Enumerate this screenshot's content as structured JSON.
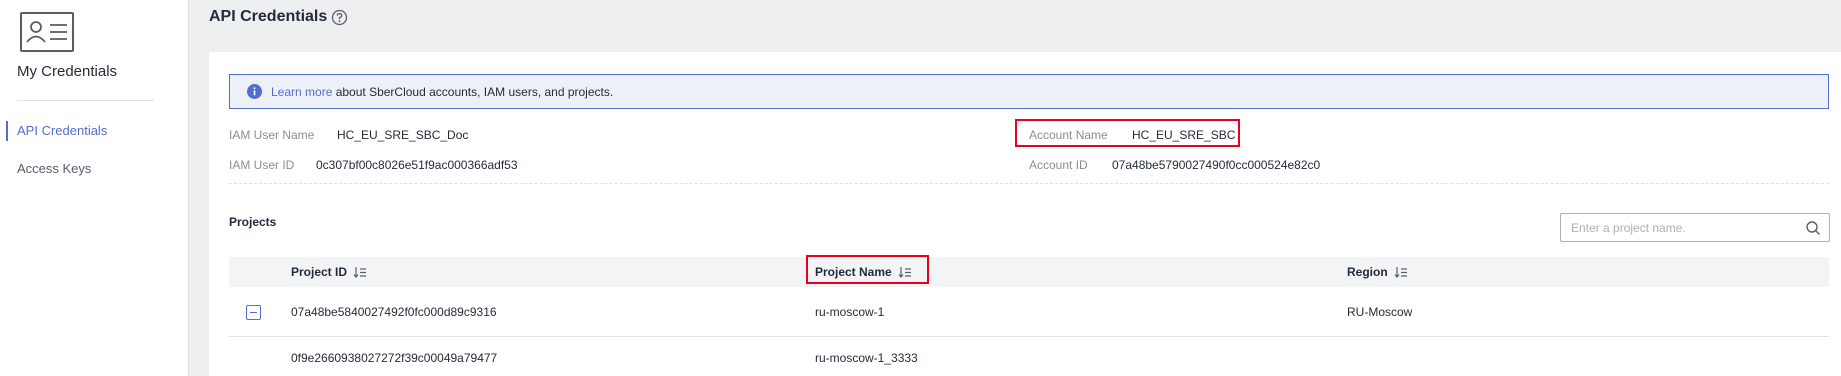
{
  "sidebar": {
    "title": "My Credentials",
    "items": [
      {
        "label": "API Credentials"
      },
      {
        "label": "Access Keys"
      }
    ]
  },
  "header": {
    "title": "API Credentials"
  },
  "banner": {
    "link": "Learn more",
    "text": " about SberCloud accounts, IAM users, and projects."
  },
  "credentials": {
    "iam_user_name_label": "IAM User Name",
    "iam_user_name": "HC_EU_SRE_SBC_Doc",
    "iam_user_id_label": "IAM User ID",
    "iam_user_id": "0c307bf00c8026e51f9ac000366adf53",
    "account_name_label": "Account Name",
    "account_name": "HC_EU_SRE_SBC",
    "account_id_label": "Account ID",
    "account_id": "07a48be5790027490f0cc000524e82c0"
  },
  "projects": {
    "title": "Projects",
    "search_placeholder": "Enter a project name.",
    "columns": [
      "Project ID",
      "Project Name",
      "Region"
    ],
    "rows": [
      {
        "id": "07a48be5840027492f0fc000d89c9316",
        "name": "ru-moscow-1",
        "region": "RU-Moscow"
      },
      {
        "id": "0f9e2660938027272f39c00049a79477",
        "name": "ru-moscow-1_3333",
        "region": ""
      }
    ]
  },
  "colors": {
    "accent": "#526ecc",
    "highlight": "#e8001c"
  }
}
